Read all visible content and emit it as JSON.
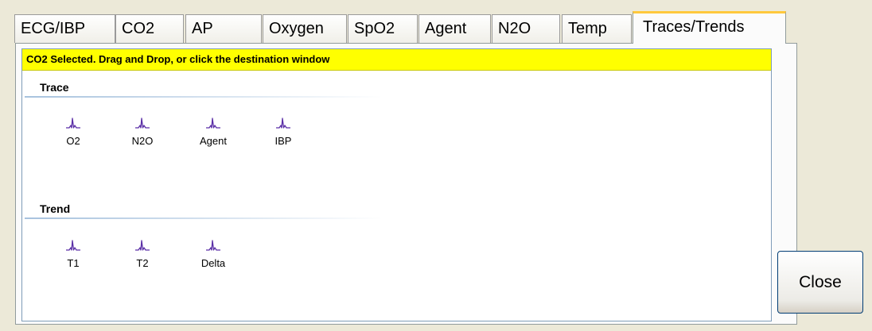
{
  "tabs": [
    {
      "label": "ECG/IBP"
    },
    {
      "label": "CO2"
    },
    {
      "label": "AP"
    },
    {
      "label": "Oxygen"
    },
    {
      "label": "SpO2"
    },
    {
      "label": "Agent"
    },
    {
      "label": "N2O"
    },
    {
      "label": "Temp"
    },
    {
      "label": "Traces/Trends"
    }
  ],
  "active_tab": "Traces/Trends",
  "status_message": "CO2 Selected. Drag and Drop, or click the destination window",
  "trace": {
    "title": "Trace",
    "items": [
      {
        "label": "O2",
        "icon": "waveform-icon"
      },
      {
        "label": "N2O",
        "icon": "waveform-icon"
      },
      {
        "label": "Agent",
        "icon": "waveform-icon"
      },
      {
        "label": "IBP",
        "icon": "waveform-icon"
      }
    ]
  },
  "trend": {
    "title": "Trend",
    "items": [
      {
        "label": "T1",
        "icon": "waveform-icon"
      },
      {
        "label": "T2",
        "icon": "waveform-icon"
      },
      {
        "label": "Delta",
        "icon": "waveform-icon"
      }
    ]
  },
  "close_label": "Close",
  "colors": {
    "status_bar": "#ffff00",
    "active_tab_accent": "#ffc83c",
    "waveform_icon": "#5a2ea6"
  }
}
